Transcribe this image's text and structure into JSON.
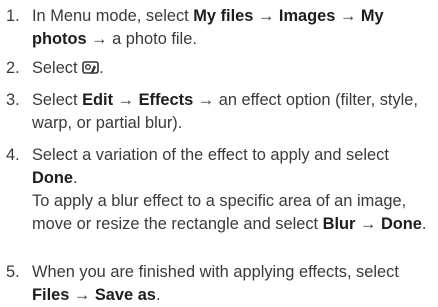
{
  "steps": [
    {
      "number": "1.",
      "parts": {
        "t1": "In Menu mode, select ",
        "b1": "My files",
        "t2": " → ",
        "b2": "Images",
        "t3": " → ",
        "b3": "My photos",
        "t4": " → a photo file."
      }
    },
    {
      "number": "2.",
      "parts": {
        "t1": "Select ",
        "icon": "photo-edit-icon",
        "t2": "."
      }
    },
    {
      "number": "3.",
      "parts": {
        "t1": "Select ",
        "b1": "Edit",
        "t2": " → ",
        "b2": "Effects",
        "t3": " → an effect option (filter, style, warp, or partial blur)."
      }
    },
    {
      "number": "4.",
      "parts": {
        "t1": "Select a variation of the effect to apply and select ",
        "b1": "Done",
        "t2": "."
      },
      "note": {
        "t1": "To apply a blur effect to a specific area of an image, move or resize the rectangle and select ",
        "b1": "Blur",
        "t2": " → ",
        "b2": "Done",
        "t3": "."
      }
    },
    {
      "number": "5.",
      "parts": {
        "t1": "When you are finished with applying effects, select ",
        "b1": "Files",
        "t2": " → ",
        "b2": "Save as",
        "t3": "."
      }
    }
  ]
}
